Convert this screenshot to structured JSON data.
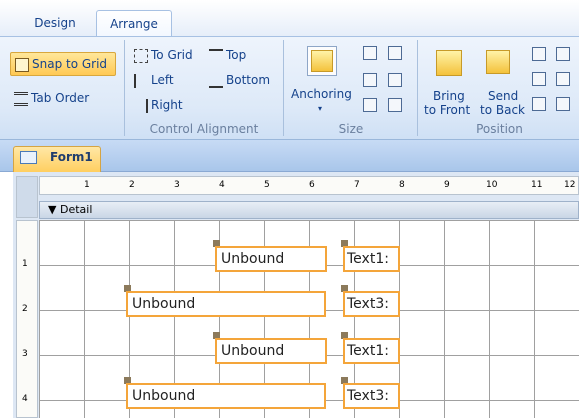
{
  "ribbon": {
    "tabs": [
      {
        "label": "Design",
        "active": false
      },
      {
        "label": "Arrange",
        "active": true
      }
    ],
    "buttons": {
      "snap_to_grid": "Snap to Grid",
      "tab_order": "Tab Order",
      "to_grid": "To Grid",
      "left": "Left",
      "right": "Right",
      "top": "Top",
      "bottom": "Bottom",
      "anchoring": "Anchoring",
      "bring_to_front_1": "Bring",
      "bring_to_front_2": "to Front",
      "send_to_back_1": "Send",
      "send_to_back_2": "to Back"
    },
    "groups": {
      "control_alignment": "Control Alignment",
      "size": "Size",
      "position": "Position"
    }
  },
  "form": {
    "title": "Form1",
    "section": "Detail",
    "ruler_top": [
      "1",
      "2",
      "3",
      "4",
      "5",
      "6",
      "7",
      "8",
      "9",
      "10",
      "11",
      "12"
    ],
    "ruler_left": [
      "1",
      "2",
      "3",
      "4"
    ],
    "controls": [
      {
        "text": "Unbound",
        "label": "Text1:"
      },
      {
        "text": "Unbound",
        "label": "Text3:"
      },
      {
        "text": "Unbound",
        "label": "Text1:"
      },
      {
        "text": "Unbound",
        "label": "Text3:"
      }
    ]
  },
  "colors": {
    "selection": "#f4a53a",
    "ribbon_text": "#15428b",
    "active_button": "#ffc954"
  }
}
